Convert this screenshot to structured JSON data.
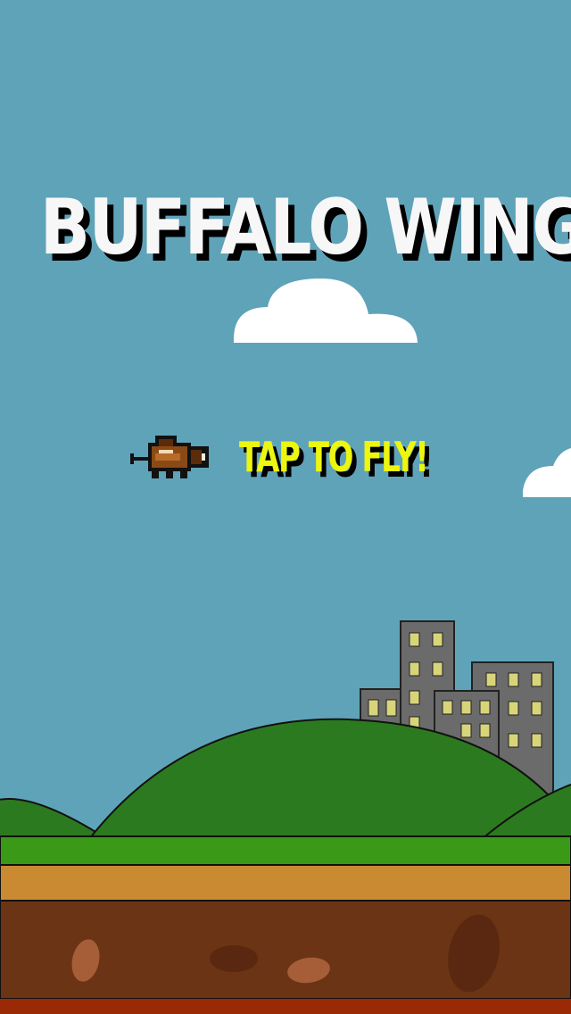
{
  "game": {
    "title": "BUFFALO WINGS",
    "prompt": "TAP TO FLY!"
  },
  "colors": {
    "sky": "#5fa3b9",
    "cloud": "#ffffff",
    "title_text": "#f7f7f7",
    "prompt_text": "#ecf60f",
    "text_shadow": "#000000",
    "hill": "#2c7a1f",
    "grass": "#3a9a17",
    "dirt_top": "#c98a31",
    "dirt": "#6b3415",
    "rock": "#a65e38",
    "lava": "#9a2a06",
    "building": "#6b6b6b",
    "window": "#d8d47a",
    "buffalo": "#8a4a16"
  },
  "icons": {
    "player": "pixel-buffalo-icon"
  }
}
